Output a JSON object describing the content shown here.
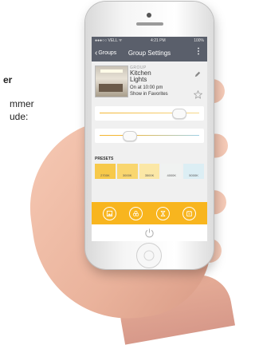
{
  "page_text": {
    "line1": "er",
    "line2": "mmer",
    "line3": "ude:"
  },
  "status_bar": {
    "carrier": "●●●○○ VELL ᯤ",
    "time": "4:21 PM",
    "battery": "100%"
  },
  "nav": {
    "back_label": "Groups",
    "title": "Group Settings",
    "more_icon": "more-vertical-icon"
  },
  "group": {
    "label": "GROUP",
    "name": "Kitchen Lights",
    "schedule": "On at 10:00 pm",
    "favorites_label": "Show in Favorites",
    "edit_icon": "pencil-icon",
    "favorite_icon": "star-outline-icon"
  },
  "sliders": {
    "brightness_level": 0.8,
    "color_temp_level": 0.3
  },
  "presets": {
    "label": "PRESETS",
    "items": [
      {
        "label": "2700K",
        "color": "#f7c94a"
      },
      {
        "label": "3000K",
        "color": "#f9d66f"
      },
      {
        "label": "3500K",
        "color": "#fbe7a6"
      },
      {
        "label": "4000K",
        "color": "#f0f2f1"
      },
      {
        "label": "5000K",
        "color": "#dceef4"
      }
    ]
  },
  "bottom_bar": {
    "icons": [
      "picture-frame-icon",
      "scenes-circles-icon",
      "hourglass-icon",
      "schedule-icon"
    ],
    "accent": "#f8b51e"
  },
  "power_icon": "power-icon"
}
